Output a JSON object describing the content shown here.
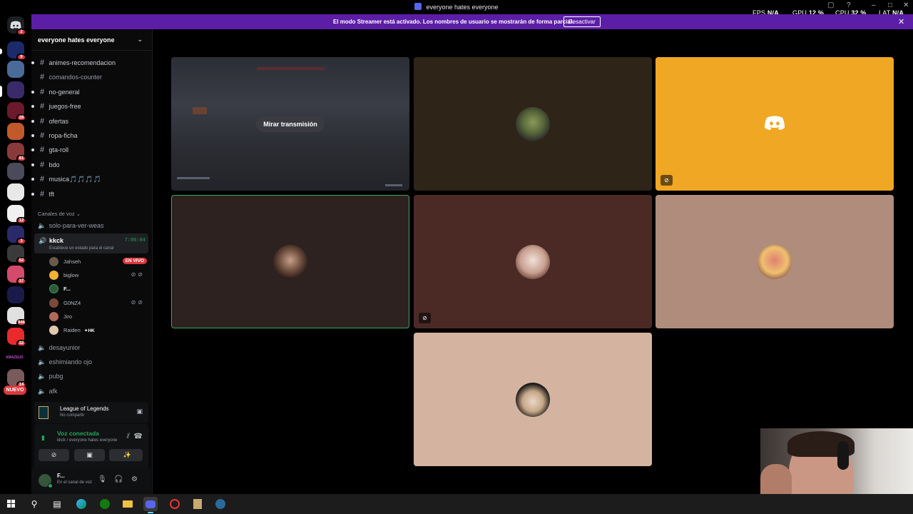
{
  "window": {
    "title": "everyone hates everyone",
    "hud": {
      "fps_label": "FPS",
      "fps": "N/A",
      "gpu_label": "GPU",
      "gpu": "12 %",
      "cpu_label": "CPU",
      "cpu": "32 %",
      "lat_label": "LAT",
      "lat": "N/A"
    }
  },
  "banner": {
    "message": "El modo Streamer está activado. Los nombres de usuario se mostrarán de forma parcial.",
    "button": "Desactivar",
    "close": "✕"
  },
  "rail": {
    "home_badge": "2",
    "badges": [
      "9",
      "28",
      "81",
      "12",
      "3",
      "52",
      "37",
      "946",
      "32",
      "14"
    ],
    "new_label": "NUEVO",
    "amazeus_label": "AMAZEUS"
  },
  "server": {
    "name": "everyone hates everyone"
  },
  "channels": [
    {
      "name": "animes-recomendacion",
      "unread": true
    },
    {
      "name": "comandos-counter",
      "unread": false
    },
    {
      "name": "no-general",
      "unread": true
    },
    {
      "name": "juegos-free",
      "unread": true
    },
    {
      "name": "ofertas",
      "unread": true
    },
    {
      "name": "ropa-ficha",
      "unread": true
    },
    {
      "name": "gta-roll",
      "unread": true
    },
    {
      "name": "bdo",
      "unread": true
    },
    {
      "name": "musica🎵🎵🎵🎵",
      "unread": true
    },
    {
      "name": "tft",
      "unread": true
    }
  ],
  "voice_category": "Canales de voz",
  "voice_channels": {
    "solo": "solo-para-ver-weas",
    "active": {
      "name": "kkck",
      "timer": "7:06:04",
      "status": "Establece un estado para el canal"
    },
    "members": [
      {
        "name": "Jahseh",
        "live": "EN VIVO",
        "color": "#6a5a4a"
      },
      {
        "name": "biglow",
        "color": "#f0b232"
      },
      {
        "name": "F...",
        "color": "#35563a"
      },
      {
        "name": "G0NZ4",
        "color": "#7a4a3a"
      },
      {
        "name": "Jiro",
        "color": "#b06a5a"
      },
      {
        "name": "Raiden",
        "tag": "HK",
        "color": "#e0c8b0"
      }
    ],
    "others": [
      "desayunior",
      "eshimiando ojo",
      "pubg",
      "afk"
    ]
  },
  "activity": {
    "game": "League of Legends",
    "sub": "No compartir"
  },
  "voice_panel": {
    "title": "Voz conectada",
    "subtitle": "kkck / everyone hates everyone"
  },
  "user": {
    "name": "F...",
    "status": "En el canal de voz"
  },
  "stream_tile": {
    "button": "Mirar transmisión"
  },
  "tiles_colors": [
    "#2e2418",
    "#f0a723",
    "#2d2220",
    "#4b2a26",
    "#b08c7c",
    "#d4b4a0"
  ],
  "accent": {
    "streamer": "#5c1ea6",
    "live": "#da373c",
    "online": "#23a55a",
    "discord": "#f0a723"
  }
}
